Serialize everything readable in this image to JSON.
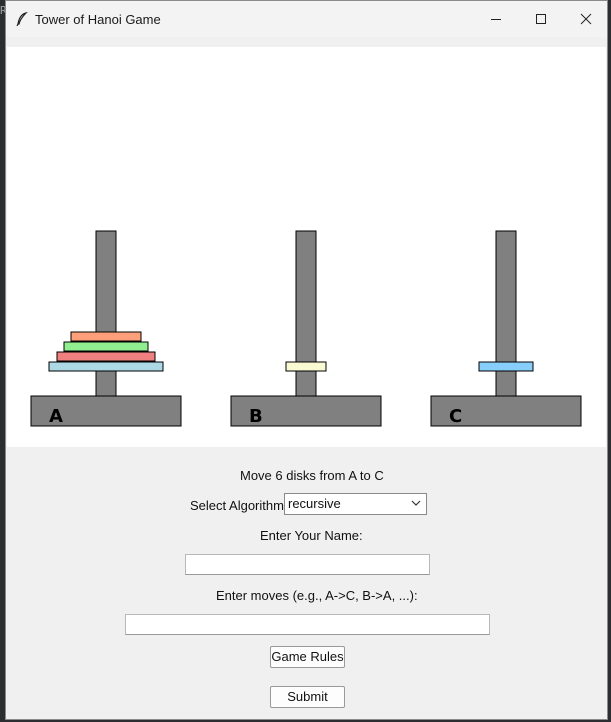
{
  "window": {
    "title": "Tower of Hanoi Game"
  },
  "game": {
    "towers": [
      {
        "label": "A",
        "disks": [
          "#add8e6",
          "#f08080",
          "#90ee90",
          "#ffa07a"
        ]
      },
      {
        "label": "B",
        "disks": [
          "#fafad2"
        ]
      },
      {
        "label": "C",
        "disks": [
          "#87cefa"
        ]
      }
    ],
    "colors": {
      "pole": "#808080",
      "base": "#808080",
      "canvas": "#ffffff"
    }
  },
  "controls": {
    "status_text": "Move 6 disks from A to C",
    "algorithm_label": "Select Algorithm:",
    "algorithm_value": "recursive",
    "name_label": "Enter Your Name:",
    "name_value": "",
    "moves_label": "Enter moves (e.g., A->C, B->A, ...):",
    "moves_value": "",
    "rules_button": "Game Rules",
    "submit_button": "Submit"
  }
}
